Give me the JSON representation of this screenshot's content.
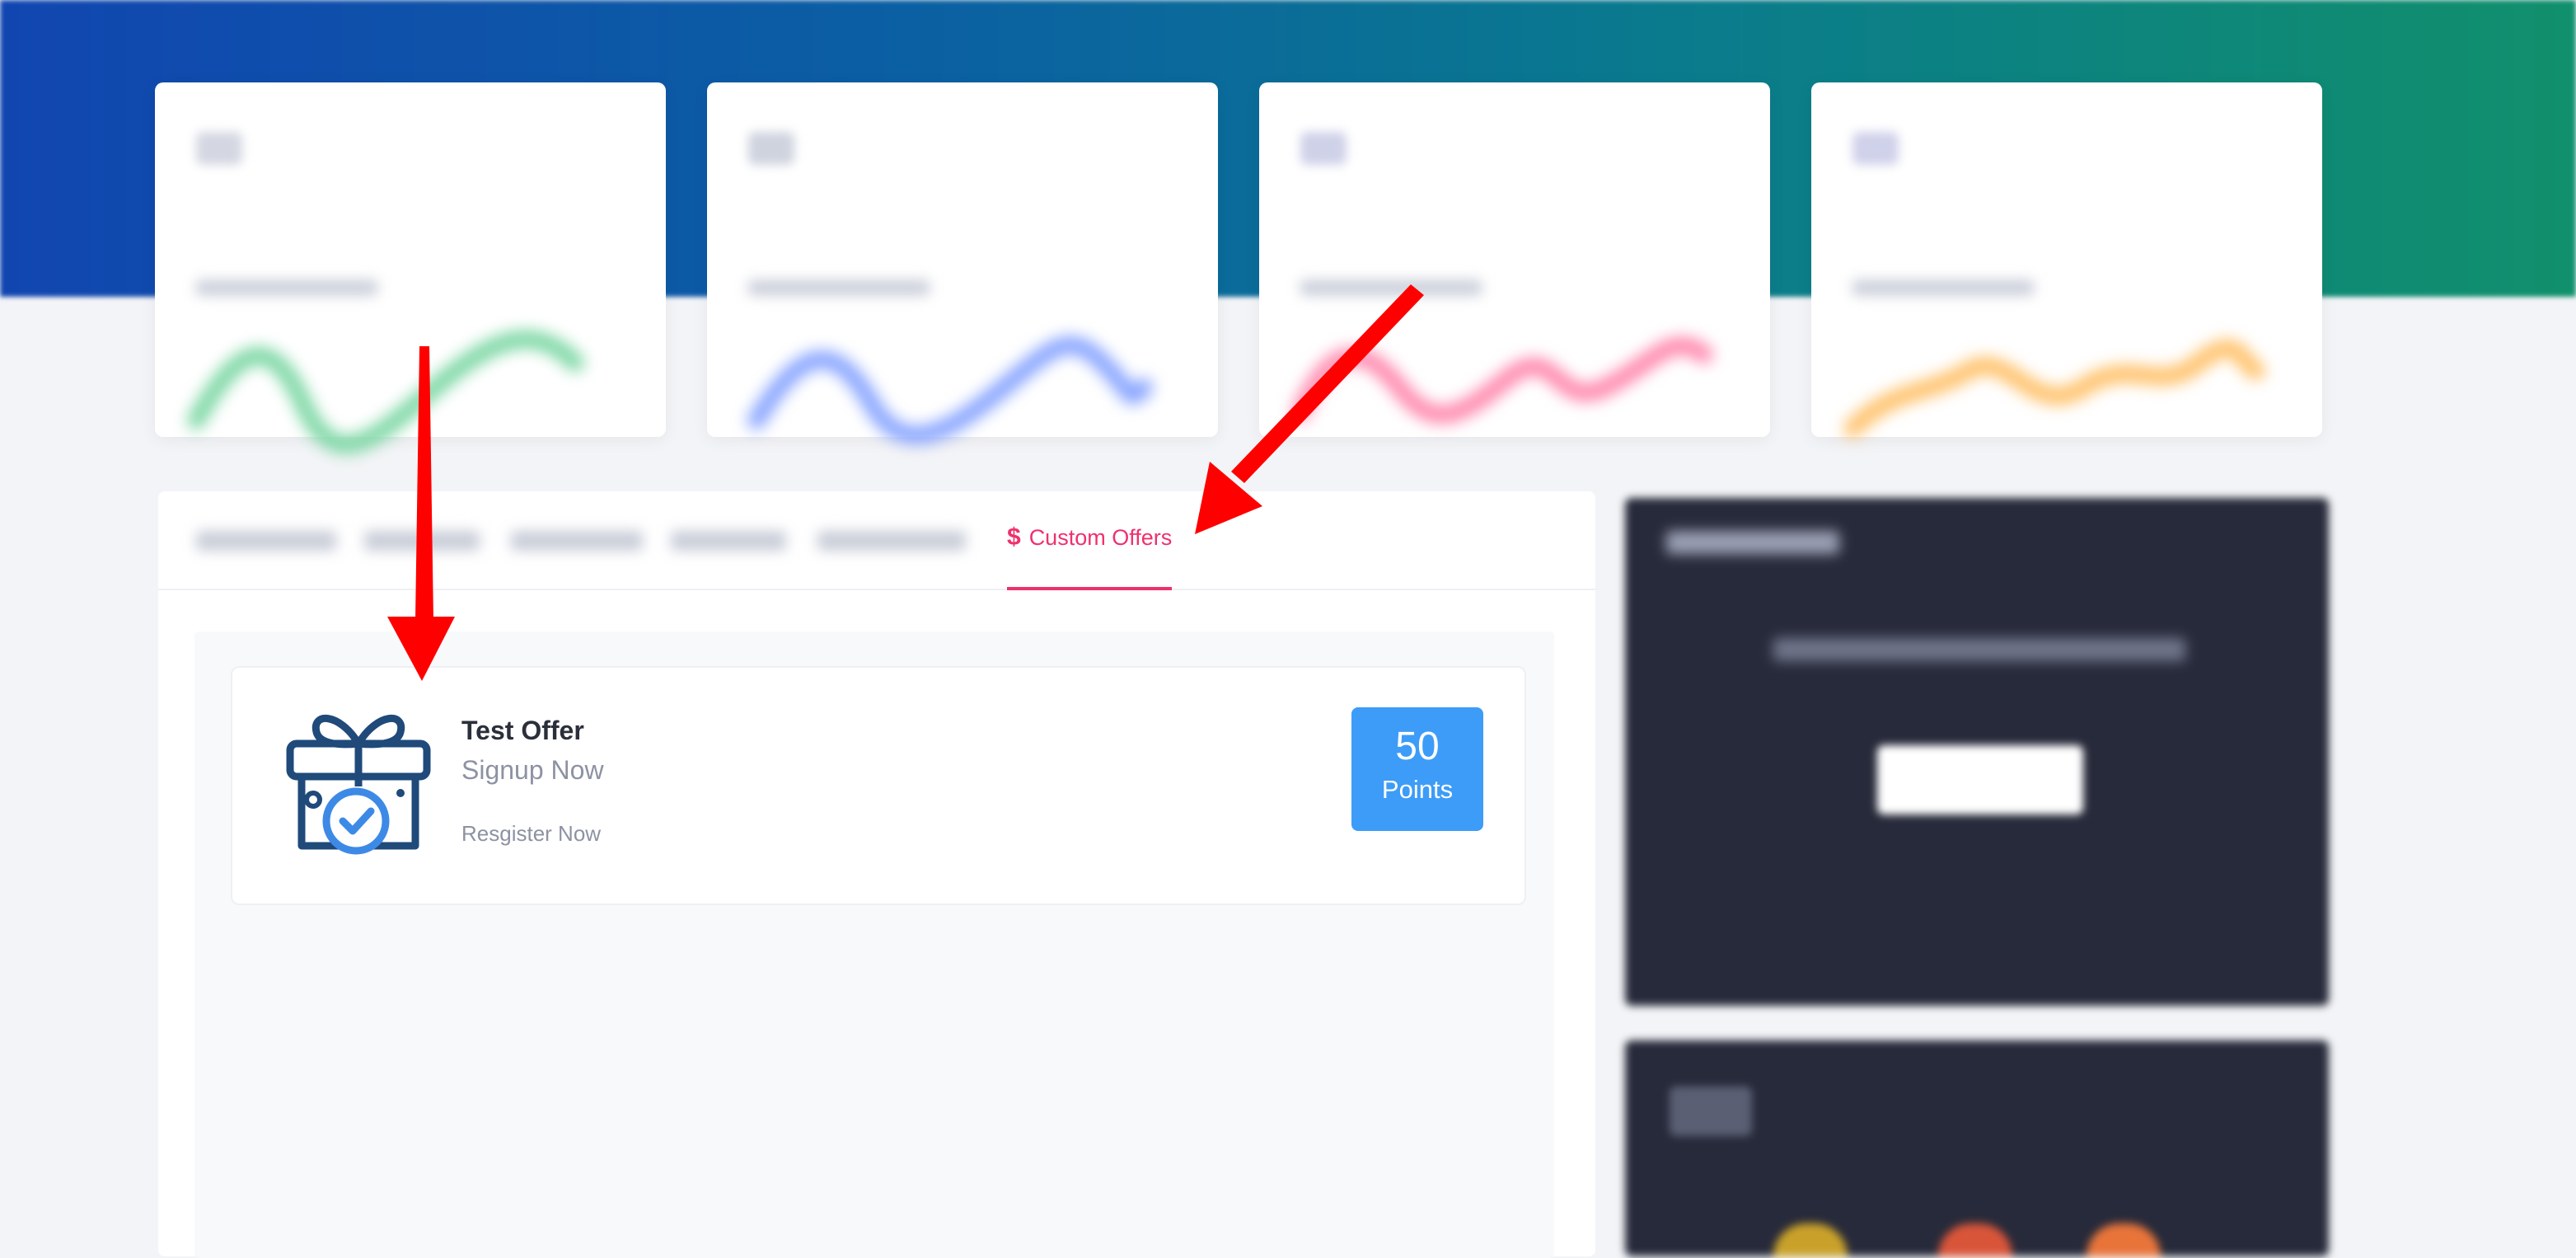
{
  "tabs": {
    "active": {
      "icon": "dollar-icon",
      "symbol": "$",
      "label": "Custom Offers"
    }
  },
  "offer": {
    "icon": "gift-box-check-icon",
    "title": "Test Offer",
    "subtitle": "Signup Now",
    "description": "Resgister Now",
    "points_value": "50",
    "points_unit": "Points"
  },
  "colors": {
    "accent": "#f0306c",
    "points_badge": "#3d9cf7",
    "annotation_arrow": "#ff0000",
    "sidebar_card": "#272a3a"
  },
  "annotations": {
    "arrows": [
      "arrow-pointing-to-offer-icon",
      "arrow-pointing-to-custom-offers-tab"
    ]
  }
}
